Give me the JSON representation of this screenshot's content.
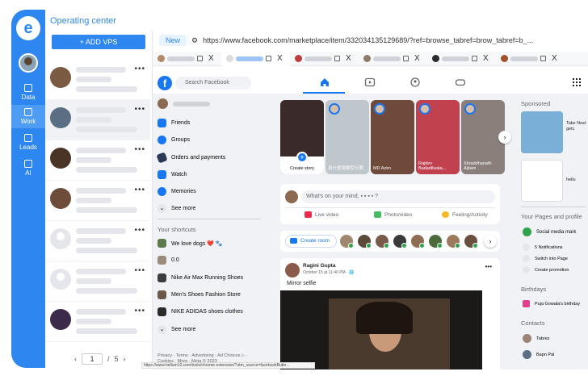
{
  "app": {
    "title": "Operating center",
    "logo_letter": "e",
    "accent_color": "#2e87f0"
  },
  "rail": {
    "items": [
      {
        "label": "Data",
        "icon": "data-icon",
        "active": false
      },
      {
        "label": "Work",
        "icon": "work-icon",
        "active": true
      },
      {
        "label": "Leads",
        "icon": "leads-icon",
        "active": false
      },
      {
        "label": "AI",
        "icon": "ai-icon",
        "active": false
      }
    ]
  },
  "profiles": {
    "add_button": "+ ADD VPS",
    "menu_glyph": "•••",
    "pagination": {
      "current": "1",
      "separator": "/",
      "total": "5",
      "prev": "‹",
      "next": "›"
    }
  },
  "browser": {
    "new_tab_label": "New",
    "url": "https://www.facebook.com/marketplace/item/332034135129689/?ref=browse_tabref=brow_tabref=b_...",
    "tab_close": "X",
    "status_url": "https://www.hellum10.com/tools/chrome-extension/?utm_source=facebookButtn..."
  },
  "facebook": {
    "logo": "f",
    "search_placeholder": "Search Facebook",
    "left_nav": [
      {
        "label": "Friends",
        "icon": "friends-icon",
        "color": "#1877f2"
      },
      {
        "label": "Groups",
        "icon": "groups-icon",
        "color": "#1877f2"
      },
      {
        "label": "Orders and payments",
        "icon": "orders-icon",
        "color": "#2b3a55"
      },
      {
        "label": "Watch",
        "icon": "watch-icon",
        "color": "#1877f2"
      },
      {
        "label": "Memories",
        "icon": "memories-icon",
        "color": "#1877f2"
      },
      {
        "label": "See more",
        "icon": "chevron-down-icon",
        "color": "#e4e6eb"
      }
    ],
    "shortcuts_title": "Your shortcuts",
    "shortcuts": [
      {
        "label": "We love dogs ❤️ 🐾"
      },
      {
        "label": "0.0"
      },
      {
        "label": "Nike Air Max Running Shoes"
      },
      {
        "label": "Men's Shoes Fashion Store"
      },
      {
        "label": "NIKE ADIDAS shoes clothes"
      },
      {
        "label": "See more"
      }
    ],
    "footer": "Privacy · Terms · Advertising · Ad Choices ▷ · Cookies · More · Meta © 2023",
    "stories": [
      {
        "name": "Create story",
        "bg": "#3a2a2a"
      },
      {
        "name": "真什麼兩類型日照",
        "bg": "#bfc6cc"
      },
      {
        "name": "MD Azim",
        "bg": "#6f4a3a"
      },
      {
        "name": "Rajdev Badadilwala...",
        "bg": "#c2414f"
      },
      {
        "name": "Shraddhanath Ajitam",
        "bg": "#8a7f7a"
      }
    ],
    "mind_placeholder": "What's on your mind, ▪ ▪ ▪ ▪ ?",
    "mind_actions": [
      {
        "label": "Live video",
        "color": "#f02849"
      },
      {
        "label": "Photo/video",
        "color": "#45bd62"
      },
      {
        "label": "Feeling/Activity",
        "color": "#f7b928"
      }
    ],
    "create_room": "Create room",
    "post": {
      "author": "Ragini Gupta",
      "time": "October 15 at 11:40 PM · 🌐",
      "text": "Mirror selfie",
      "menu": "•••"
    },
    "right": {
      "sponsored_title": "Sponsored",
      "sponsored": [
        {
          "text": "Take Next getc"
        },
        {
          "text": "hellu"
        }
      ],
      "pages_title": "Your Pages and profile",
      "page_name": "Social media mark",
      "page_actions": [
        "5 Notifications",
        "Switch into Page",
        "Create promotion"
      ],
      "birthdays_title": "Birthdays",
      "birthday_text": "Puja Gowala's birthday",
      "contacts_title": "Contacts",
      "contacts": [
        "Tabrez",
        "Bapn Pal"
      ]
    }
  }
}
